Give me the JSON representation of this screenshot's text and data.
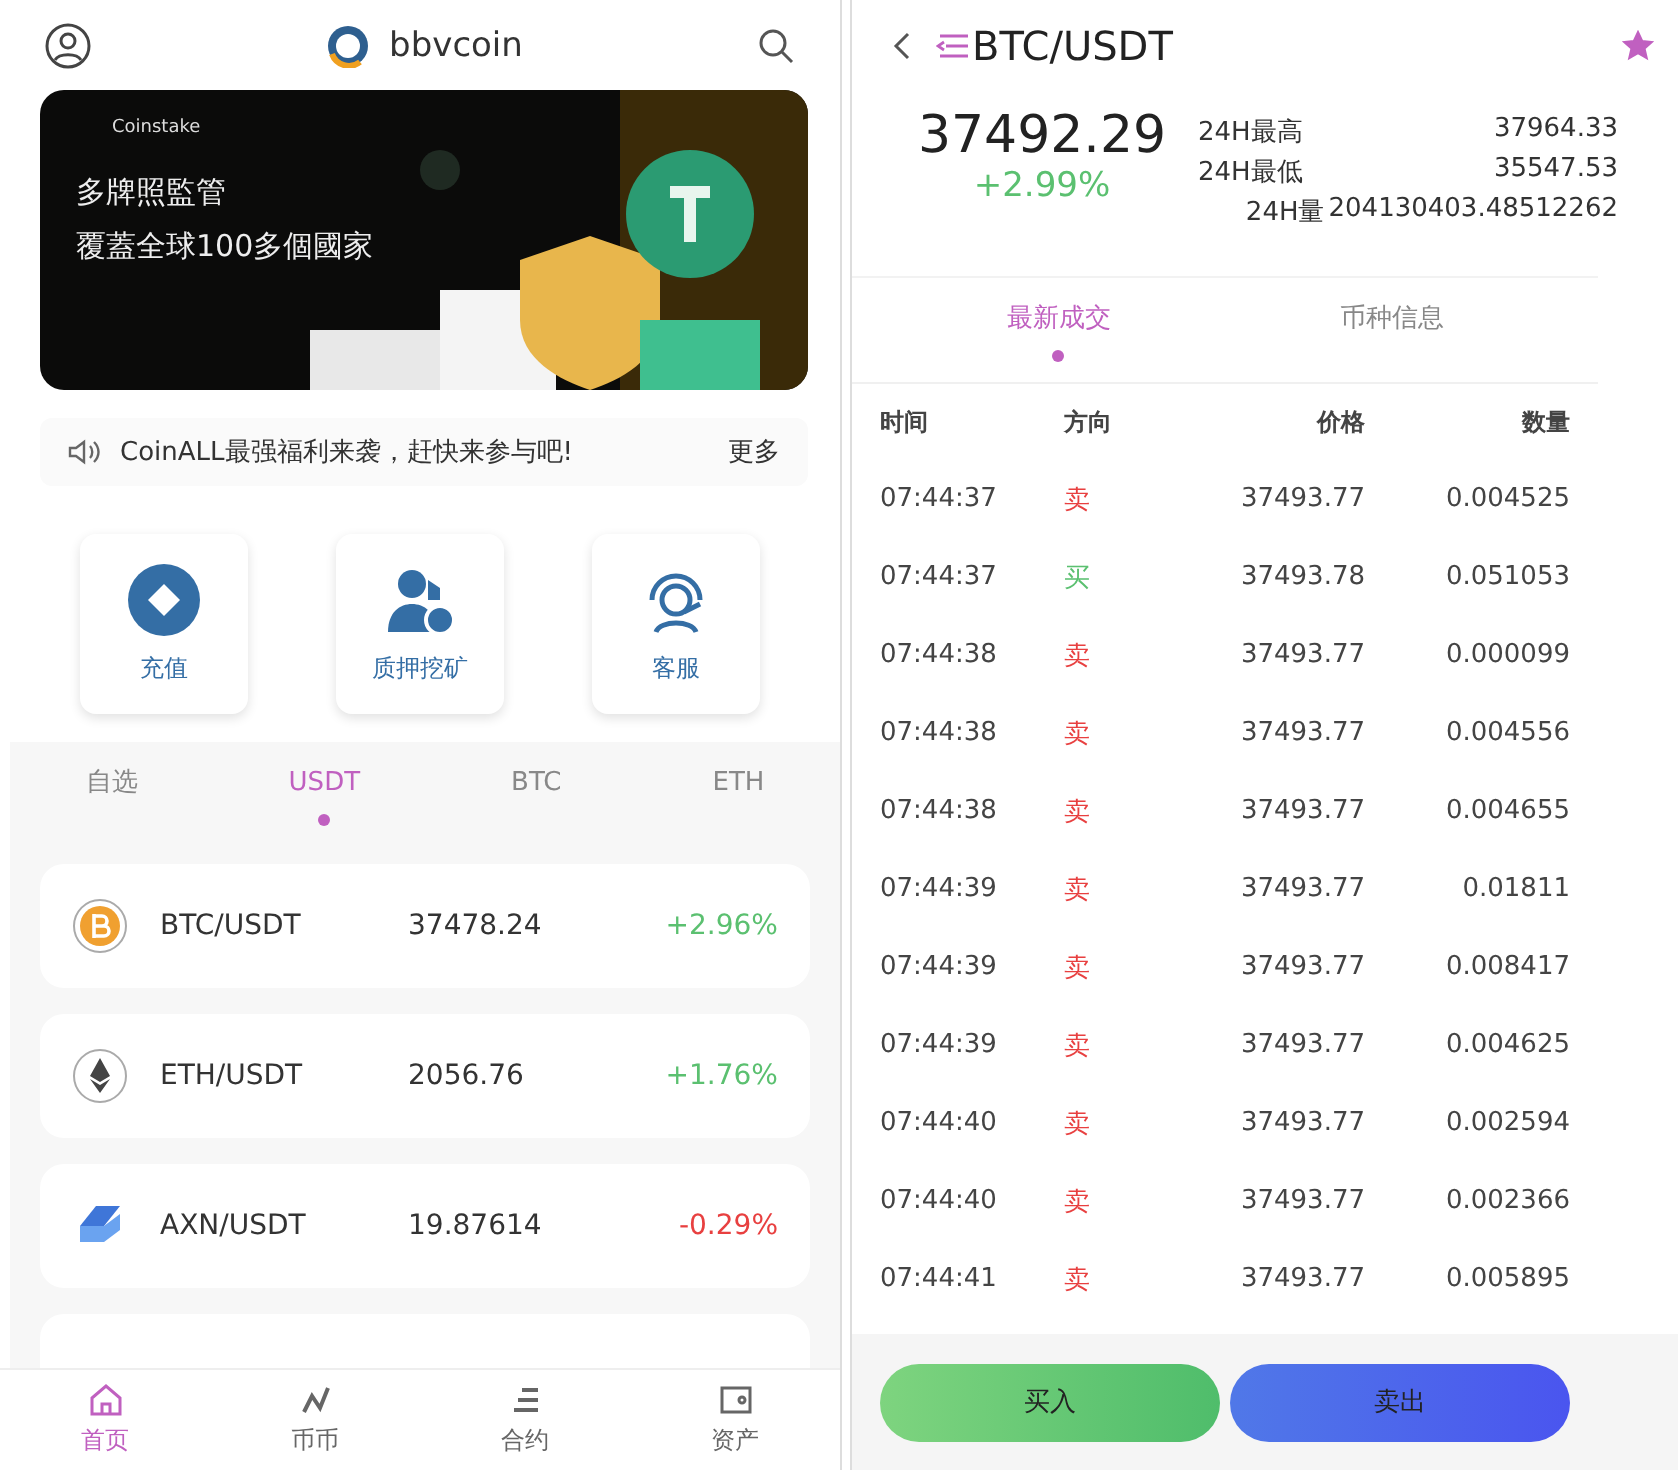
{
  "home": {
    "header": {
      "title": "bbvcoin"
    },
    "banner": {
      "kind": "picture",
      "brand": "Coinstake",
      "lines": [
        "多牌照監管",
        "覆蓋全球100多個國家"
      ]
    },
    "notice": {
      "text": "CoinALL最强福利来袭，赶快来参与吧!",
      "more": "更多"
    },
    "shortcuts": [
      {
        "label": "充值",
        "kind": "deposit"
      },
      {
        "label": "质押挖矿",
        "kind": "mining"
      },
      {
        "label": "客服",
        "kind": "support"
      }
    ],
    "market_tabs": [
      {
        "label": "自选",
        "selected": false
      },
      {
        "label": "USDT",
        "selected": true
      },
      {
        "label": "BTC",
        "selected": false
      },
      {
        "label": "ETH",
        "selected": false
      }
    ],
    "coins": [
      {
        "pair": "BTC/USDT",
        "price": "37478.24",
        "change": "+2.96%",
        "up": true,
        "kind": "btc"
      },
      {
        "pair": "ETH/USDT",
        "price": "2056.76",
        "change": "+1.76%",
        "up": true,
        "kind": "eth"
      },
      {
        "pair": "AXN/USDT",
        "price": "19.87614",
        "change": "-0.29%",
        "up": false,
        "kind": "axn"
      }
    ],
    "bottom_nav": [
      {
        "label": "首页",
        "kind": "home",
        "selected": true
      },
      {
        "label": "币币",
        "kind": "spot",
        "selected": false
      },
      {
        "label": "合约",
        "kind": "contract",
        "selected": false
      },
      {
        "label": "资产",
        "kind": "wallet",
        "selected": false
      }
    ]
  },
  "detail": {
    "header": {
      "title": "BTC/USDT",
      "favorite": true
    },
    "price": "37492.29",
    "change": "+2.99%",
    "up": true,
    "stats": [
      {
        "label": "24H最高",
        "value": "37964.33"
      },
      {
        "label": "24H最低",
        "value": "35547.53"
      },
      {
        "label": "24H量",
        "value": "204130403.48512262"
      }
    ],
    "tabs": [
      {
        "label": "最新成交",
        "selected": true
      },
      {
        "label": "币种信息",
        "selected": false
      }
    ],
    "columns": [
      "时间",
      "方向",
      "价格",
      "数量"
    ],
    "trades": [
      {
        "time": "07:44:37",
        "side": "卖",
        "buy": false,
        "price": "37493.77",
        "amount": "0.004525"
      },
      {
        "time": "07:44:37",
        "side": "买",
        "buy": true,
        "price": "37493.78",
        "amount": "0.051053"
      },
      {
        "time": "07:44:38",
        "side": "卖",
        "buy": false,
        "price": "37493.77",
        "amount": "0.000099"
      },
      {
        "time": "07:44:38",
        "side": "卖",
        "buy": false,
        "price": "37493.77",
        "amount": "0.004556"
      },
      {
        "time": "07:44:38",
        "side": "卖",
        "buy": false,
        "price": "37493.77",
        "amount": "0.004655"
      },
      {
        "time": "07:44:39",
        "side": "卖",
        "buy": false,
        "price": "37493.77",
        "amount": "0.01811"
      },
      {
        "time": "07:44:39",
        "side": "卖",
        "buy": false,
        "price": "37493.77",
        "amount": "0.008417"
      },
      {
        "time": "07:44:39",
        "side": "卖",
        "buy": false,
        "price": "37493.77",
        "amount": "0.004625"
      },
      {
        "time": "07:44:40",
        "side": "卖",
        "buy": false,
        "price": "37493.77",
        "amount": "0.002594"
      },
      {
        "time": "07:44:40",
        "side": "卖",
        "buy": false,
        "price": "37493.77",
        "amount": "0.002366"
      },
      {
        "time": "07:44:41",
        "side": "卖",
        "buy": false,
        "price": "37493.77",
        "amount": "0.005895"
      }
    ],
    "buy_button": "买入",
    "sell_button": "卖出"
  }
}
